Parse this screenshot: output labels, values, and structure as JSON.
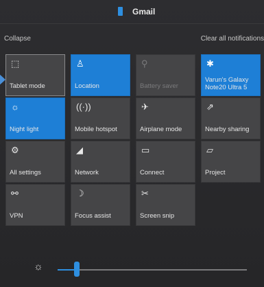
{
  "header": {
    "app_name": "Gmail"
  },
  "actions": {
    "collapse": "Collapse",
    "clear_all": "Clear all notifications"
  },
  "tiles": [
    {
      "label": "Tablet mode",
      "icon": "tablet-mode-icon",
      "glyph": "⬚",
      "state": "off"
    },
    {
      "label": "Location",
      "icon": "location-icon",
      "glyph": "♙",
      "state": "on"
    },
    {
      "label": "Battery saver",
      "icon": "battery-saver-icon",
      "glyph": "⚲",
      "state": "disabled"
    },
    {
      "label": "Varun's Galaxy Note20 Ultra 5",
      "icon": "bluetooth-icon",
      "glyph": "✱",
      "state": "on"
    },
    {
      "label": "Night light",
      "icon": "night-light-icon",
      "glyph": "☼",
      "state": "on"
    },
    {
      "label": "Mobile hotspot",
      "icon": "mobile-hotspot-icon",
      "glyph": "((·))",
      "state": "off"
    },
    {
      "label": "Airplane mode",
      "icon": "airplane-icon",
      "glyph": "✈",
      "state": "off"
    },
    {
      "label": "Nearby sharing",
      "icon": "nearby-sharing-icon",
      "glyph": "⇗",
      "state": "off"
    },
    {
      "label": "All settings",
      "icon": "gear-icon",
      "glyph": "⚙",
      "state": "off"
    },
    {
      "label": "Network",
      "icon": "network-icon",
      "glyph": "◢",
      "state": "off"
    },
    {
      "label": "Connect",
      "icon": "connect-icon",
      "glyph": "▭",
      "state": "off"
    },
    {
      "label": "Project",
      "icon": "project-icon",
      "glyph": "▱",
      "state": "off"
    },
    {
      "label": "VPN",
      "icon": "vpn-icon",
      "glyph": "⚯",
      "state": "off"
    },
    {
      "label": "Focus assist",
      "icon": "focus-assist-icon",
      "glyph": "☽",
      "state": "off"
    },
    {
      "label": "Screen snip",
      "icon": "screen-snip-icon",
      "glyph": "✂",
      "state": "off"
    }
  ],
  "brightness": {
    "icon": "brightness-icon",
    "glyph": "☼",
    "level": 0.1
  },
  "colors": {
    "accent": "#1e7fd6",
    "tile_off": "#454547",
    "background": "#2a2a2c"
  }
}
